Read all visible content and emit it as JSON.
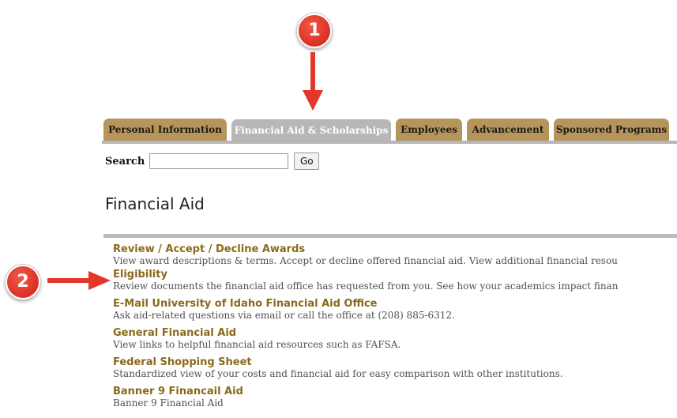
{
  "annotations": {
    "step1": "1",
    "step2": "2",
    "color": "#e2372a"
  },
  "tabs": [
    {
      "label": "Personal Information",
      "active": false
    },
    {
      "label": "Financial Aid & Scholarships",
      "active": true
    },
    {
      "label": "Employees",
      "active": false
    },
    {
      "label": "Advancement",
      "active": false
    },
    {
      "label": "Sponsored Programs",
      "active": false
    }
  ],
  "search": {
    "label": "Search",
    "value": "",
    "button_label": "Go"
  },
  "page_title": "Financial Aid",
  "menu": [
    {
      "title": "Review / Accept / Decline Awards",
      "description": "View award descriptions & terms. Accept or decline offered financial aid. View additional financial resou"
    },
    {
      "title": "Eligibility",
      "description": "Review documents the financial aid office has requested from you. See how your academics impact finan"
    },
    {
      "title": "E-Mail University of Idaho Financial Aid Office",
      "description": "Ask aid-related questions via email or call the office at (208) 885-6312."
    },
    {
      "title": "General Financial Aid",
      "description": "View links to helpful financial aid resources such as FAFSA."
    },
    {
      "title": "Federal Shopping Sheet",
      "description": "Standardized view of your costs and financial aid for easy comparison with other institutions."
    },
    {
      "title": "Banner 9 Financail Aid",
      "description": "Banner 9 Financial Aid"
    }
  ],
  "colors": {
    "tab_inactive": "#b6955d",
    "tab_active": "#b7b7b7",
    "link": "#8a6a1a"
  }
}
